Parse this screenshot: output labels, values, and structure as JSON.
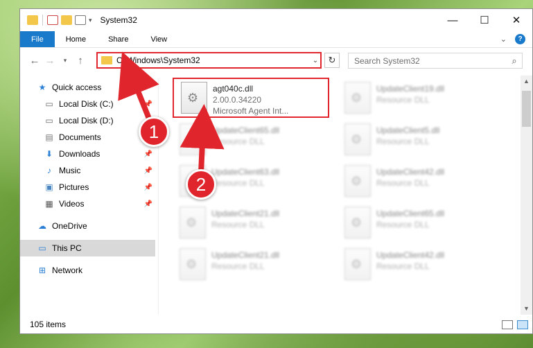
{
  "window": {
    "title": "System32",
    "controls": {
      "minimize": "—",
      "maximize": "☐",
      "close": "✕"
    }
  },
  "ribbon": {
    "tabs": [
      "File",
      "Home",
      "Share",
      "View"
    ],
    "help_icon": "question-icon"
  },
  "address_bar": {
    "path": "C:\\Windows\\System32"
  },
  "search": {
    "placeholder": "Search System32"
  },
  "sidebar": {
    "items": [
      {
        "label": "Quick access",
        "icon": "star-icon",
        "pinned": false
      },
      {
        "label": "Local Disk (C:)",
        "icon": "drive-icon",
        "pinned": true
      },
      {
        "label": "Local Disk (D:)",
        "icon": "drive-icon",
        "pinned": false
      },
      {
        "label": "Documents",
        "icon": "document-icon",
        "pinned": true
      },
      {
        "label": "Downloads",
        "icon": "download-icon",
        "pinned": true
      },
      {
        "label": "Music",
        "icon": "music-icon",
        "pinned": true
      },
      {
        "label": "Pictures",
        "icon": "picture-icon",
        "pinned": true
      },
      {
        "label": "Videos",
        "icon": "video-icon",
        "pinned": true
      },
      {
        "label": "OneDrive",
        "icon": "cloud-icon",
        "pinned": false
      },
      {
        "label": "This PC",
        "icon": "computer-icon",
        "pinned": false,
        "selected": true
      },
      {
        "label": "Network",
        "icon": "network-icon",
        "pinned": false
      }
    ]
  },
  "files": [
    {
      "name": "agt040c.dll",
      "line2": "2.00.0.34220",
      "line3": "Microsoft Agent Int...",
      "highlighted": true
    },
    {
      "name": "UpdateClient19.dll",
      "line2": "Resource DLL"
    },
    {
      "name": "UpdateClient65.dll",
      "line2": "Resource DLL"
    },
    {
      "name": "UpdateClient5.dll",
      "line2": "Resource DLL"
    },
    {
      "name": "UpdateClient63.dll",
      "line2": "Resource DLL"
    },
    {
      "name": "UpdateClient42.dll",
      "line2": "Resource DLL"
    },
    {
      "name": "UpdateClient21.dll",
      "line2": "Resource DLL"
    },
    {
      "name": "UpdateClient65.dll",
      "line2": "Resource DLL"
    },
    {
      "name": "UpdateClient21.dll",
      "line2": "Resource DLL"
    },
    {
      "name": "UpdateClient42.dll",
      "line2": "Resource DLL"
    }
  ],
  "status": {
    "item_count": "105 items"
  },
  "annotations": {
    "callout_1": "1",
    "callout_2": "2",
    "color": "#e0262c"
  }
}
